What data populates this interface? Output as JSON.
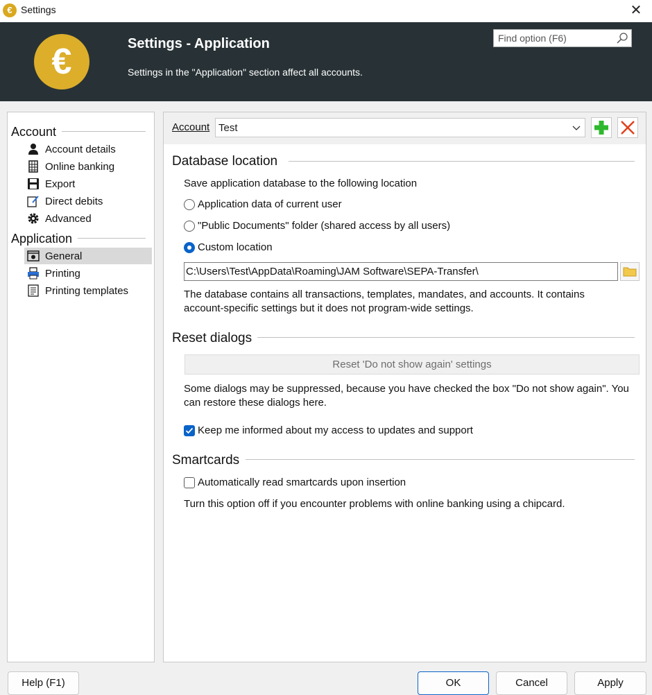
{
  "window": {
    "title": "Settings",
    "close_symbol": "✕"
  },
  "header": {
    "logo_symbol": "€",
    "title": "Settings - Application",
    "subtitle": "Settings in the \"Application\" section affect all accounts.",
    "search_placeholder": "Find option (F6)"
  },
  "sidebar": {
    "groups": [
      {
        "heading": "Account",
        "items": [
          {
            "label": "Account details",
            "icon": "user-icon"
          },
          {
            "label": "Online banking",
            "icon": "bank-grid-icon"
          },
          {
            "label": "Export",
            "icon": "save-disk-icon"
          },
          {
            "label": "Direct debits",
            "icon": "edit-document-icon"
          },
          {
            "label": "Advanced",
            "icon": "gear-icon"
          }
        ]
      },
      {
        "heading": "Application",
        "items": [
          {
            "label": "General",
            "icon": "general-settings-icon",
            "selected": true
          },
          {
            "label": "Printing",
            "icon": "printer-icon"
          },
          {
            "label": "Printing templates",
            "icon": "template-document-icon"
          }
        ]
      }
    ]
  },
  "account_bar": {
    "label": "Account",
    "selected_account": "Test"
  },
  "database_location": {
    "heading": "Database location",
    "intro": "Save application database to the following location",
    "options": [
      {
        "label": "Application data of current user",
        "checked": false
      },
      {
        "label": "\"Public Documents\" folder (shared access by all users)",
        "checked": false
      },
      {
        "label": "Custom location",
        "checked": true
      }
    ],
    "path": "C:\\Users\\Test\\AppData\\Roaming\\JAM Software\\SEPA-Transfer\\",
    "note_line1": "The database contains all transactions, templates, mandates, and accounts. It contains",
    "note_line2": "account-specific settings but it does not program-wide settings."
  },
  "reset_dialogs": {
    "heading": "Reset dialogs",
    "button": "Reset 'Do not show again' settings",
    "note_line1": "Some dialogs may be suppressed, because you have checked the box \"Do not show again\". You",
    "note_line2": "can restore these dialogs here.",
    "keep_informed_label": "Keep me informed about my access to updates and support",
    "keep_informed_checked": true
  },
  "smartcards": {
    "heading": "Smartcards",
    "auto_read_label": "Automatically read smartcards upon insertion",
    "auto_read_checked": false,
    "note": "Turn this option off if you encounter problems with online banking using a chipcard."
  },
  "footer": {
    "help": "Help (F1)",
    "ok": "OK",
    "cancel": "Cancel",
    "apply": "Apply"
  },
  "colors": {
    "header_bg": "#283236",
    "logo_gold": "#dcae2a",
    "accent_blue": "#0a63c9",
    "add_green": "#2eb82e",
    "delete_red": "#e0401a",
    "folder_yellow": "#f2c94c"
  }
}
